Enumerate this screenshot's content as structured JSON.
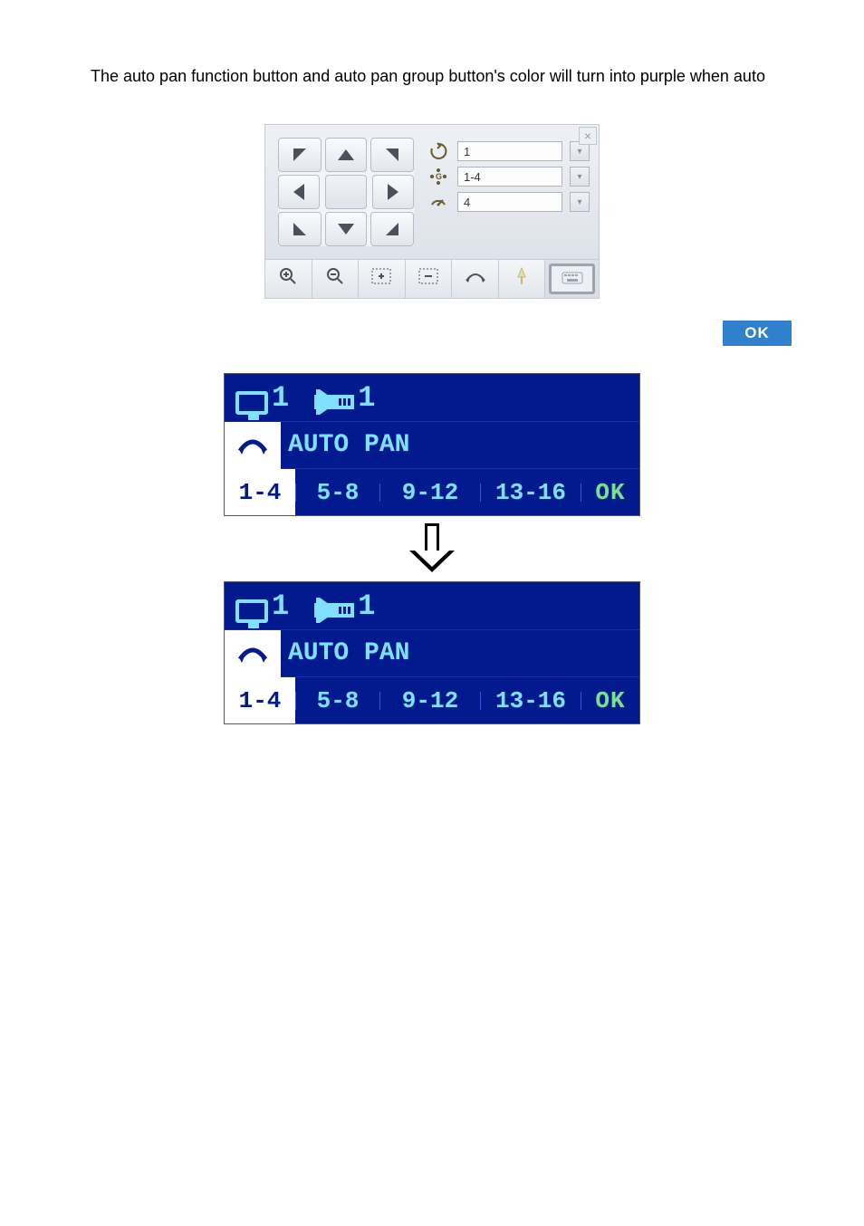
{
  "intro_text": "The auto pan function button and auto pan group button's color will turn into purple when auto",
  "ptz": {
    "preset_value": "1",
    "group_value": "1-4",
    "speed_value": "4"
  },
  "ok_pill": "OK",
  "lcd_before": {
    "camera_num": "1",
    "flag_num": "1",
    "autopan_label": "AUTO PAN",
    "groups": [
      "1-4",
      "5-8",
      "9-12",
      "13-16"
    ],
    "ok": "OK"
  },
  "lcd_after": {
    "camera_num": "1",
    "flag_num": "1",
    "autopan_label": "AUTO PAN",
    "groups": [
      "1-4",
      "5-8",
      "9-12",
      "13-16"
    ],
    "ok": "OK"
  }
}
